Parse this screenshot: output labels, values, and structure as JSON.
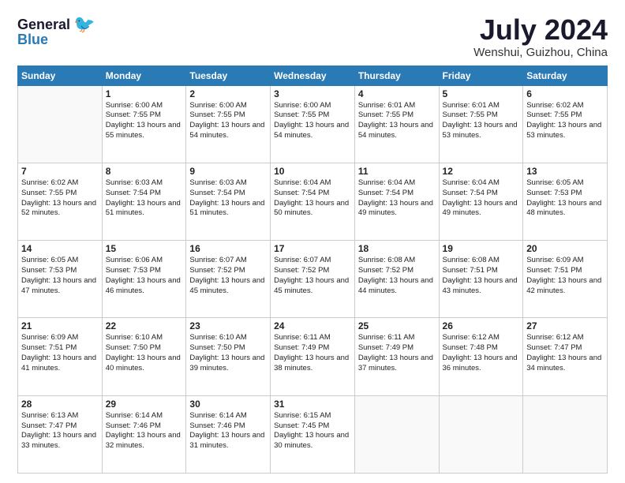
{
  "header": {
    "logo_general": "General",
    "logo_blue": "Blue",
    "month_title": "July 2024",
    "location": "Wenshui, Guizhou, China"
  },
  "weekdays": [
    "Sunday",
    "Monday",
    "Tuesday",
    "Wednesday",
    "Thursday",
    "Friday",
    "Saturday"
  ],
  "weeks": [
    [
      {
        "day": "",
        "sunrise": "",
        "sunset": "",
        "daylight": ""
      },
      {
        "day": "1",
        "sunrise": "Sunrise: 6:00 AM",
        "sunset": "Sunset: 7:55 PM",
        "daylight": "Daylight: 13 hours and 55 minutes."
      },
      {
        "day": "2",
        "sunrise": "Sunrise: 6:00 AM",
        "sunset": "Sunset: 7:55 PM",
        "daylight": "Daylight: 13 hours and 54 minutes."
      },
      {
        "day": "3",
        "sunrise": "Sunrise: 6:00 AM",
        "sunset": "Sunset: 7:55 PM",
        "daylight": "Daylight: 13 hours and 54 minutes."
      },
      {
        "day": "4",
        "sunrise": "Sunrise: 6:01 AM",
        "sunset": "Sunset: 7:55 PM",
        "daylight": "Daylight: 13 hours and 54 minutes."
      },
      {
        "day": "5",
        "sunrise": "Sunrise: 6:01 AM",
        "sunset": "Sunset: 7:55 PM",
        "daylight": "Daylight: 13 hours and 53 minutes."
      },
      {
        "day": "6",
        "sunrise": "Sunrise: 6:02 AM",
        "sunset": "Sunset: 7:55 PM",
        "daylight": "Daylight: 13 hours and 53 minutes."
      }
    ],
    [
      {
        "day": "7",
        "sunrise": "Sunrise: 6:02 AM",
        "sunset": "Sunset: 7:55 PM",
        "daylight": "Daylight: 13 hours and 52 minutes."
      },
      {
        "day": "8",
        "sunrise": "Sunrise: 6:03 AM",
        "sunset": "Sunset: 7:54 PM",
        "daylight": "Daylight: 13 hours and 51 minutes."
      },
      {
        "day": "9",
        "sunrise": "Sunrise: 6:03 AM",
        "sunset": "Sunset: 7:54 PM",
        "daylight": "Daylight: 13 hours and 51 minutes."
      },
      {
        "day": "10",
        "sunrise": "Sunrise: 6:04 AM",
        "sunset": "Sunset: 7:54 PM",
        "daylight": "Daylight: 13 hours and 50 minutes."
      },
      {
        "day": "11",
        "sunrise": "Sunrise: 6:04 AM",
        "sunset": "Sunset: 7:54 PM",
        "daylight": "Daylight: 13 hours and 49 minutes."
      },
      {
        "day": "12",
        "sunrise": "Sunrise: 6:04 AM",
        "sunset": "Sunset: 7:54 PM",
        "daylight": "Daylight: 13 hours and 49 minutes."
      },
      {
        "day": "13",
        "sunrise": "Sunrise: 6:05 AM",
        "sunset": "Sunset: 7:53 PM",
        "daylight": "Daylight: 13 hours and 48 minutes."
      }
    ],
    [
      {
        "day": "14",
        "sunrise": "Sunrise: 6:05 AM",
        "sunset": "Sunset: 7:53 PM",
        "daylight": "Daylight: 13 hours and 47 minutes."
      },
      {
        "day": "15",
        "sunrise": "Sunrise: 6:06 AM",
        "sunset": "Sunset: 7:53 PM",
        "daylight": "Daylight: 13 hours and 46 minutes."
      },
      {
        "day": "16",
        "sunrise": "Sunrise: 6:07 AM",
        "sunset": "Sunset: 7:52 PM",
        "daylight": "Daylight: 13 hours and 45 minutes."
      },
      {
        "day": "17",
        "sunrise": "Sunrise: 6:07 AM",
        "sunset": "Sunset: 7:52 PM",
        "daylight": "Daylight: 13 hours and 45 minutes."
      },
      {
        "day": "18",
        "sunrise": "Sunrise: 6:08 AM",
        "sunset": "Sunset: 7:52 PM",
        "daylight": "Daylight: 13 hours and 44 minutes."
      },
      {
        "day": "19",
        "sunrise": "Sunrise: 6:08 AM",
        "sunset": "Sunset: 7:51 PM",
        "daylight": "Daylight: 13 hours and 43 minutes."
      },
      {
        "day": "20",
        "sunrise": "Sunrise: 6:09 AM",
        "sunset": "Sunset: 7:51 PM",
        "daylight": "Daylight: 13 hours and 42 minutes."
      }
    ],
    [
      {
        "day": "21",
        "sunrise": "Sunrise: 6:09 AM",
        "sunset": "Sunset: 7:51 PM",
        "daylight": "Daylight: 13 hours and 41 minutes."
      },
      {
        "day": "22",
        "sunrise": "Sunrise: 6:10 AM",
        "sunset": "Sunset: 7:50 PM",
        "daylight": "Daylight: 13 hours and 40 minutes."
      },
      {
        "day": "23",
        "sunrise": "Sunrise: 6:10 AM",
        "sunset": "Sunset: 7:50 PM",
        "daylight": "Daylight: 13 hours and 39 minutes."
      },
      {
        "day": "24",
        "sunrise": "Sunrise: 6:11 AM",
        "sunset": "Sunset: 7:49 PM",
        "daylight": "Daylight: 13 hours and 38 minutes."
      },
      {
        "day": "25",
        "sunrise": "Sunrise: 6:11 AM",
        "sunset": "Sunset: 7:49 PM",
        "daylight": "Daylight: 13 hours and 37 minutes."
      },
      {
        "day": "26",
        "sunrise": "Sunrise: 6:12 AM",
        "sunset": "Sunset: 7:48 PM",
        "daylight": "Daylight: 13 hours and 36 minutes."
      },
      {
        "day": "27",
        "sunrise": "Sunrise: 6:12 AM",
        "sunset": "Sunset: 7:47 PM",
        "daylight": "Daylight: 13 hours and 34 minutes."
      }
    ],
    [
      {
        "day": "28",
        "sunrise": "Sunrise: 6:13 AM",
        "sunset": "Sunset: 7:47 PM",
        "daylight": "Daylight: 13 hours and 33 minutes."
      },
      {
        "day": "29",
        "sunrise": "Sunrise: 6:14 AM",
        "sunset": "Sunset: 7:46 PM",
        "daylight": "Daylight: 13 hours and 32 minutes."
      },
      {
        "day": "30",
        "sunrise": "Sunrise: 6:14 AM",
        "sunset": "Sunset: 7:46 PM",
        "daylight": "Daylight: 13 hours and 31 minutes."
      },
      {
        "day": "31",
        "sunrise": "Sunrise: 6:15 AM",
        "sunset": "Sunset: 7:45 PM",
        "daylight": "Daylight: 13 hours and 30 minutes."
      },
      {
        "day": "",
        "sunrise": "",
        "sunset": "",
        "daylight": ""
      },
      {
        "day": "",
        "sunrise": "",
        "sunset": "",
        "daylight": ""
      },
      {
        "day": "",
        "sunrise": "",
        "sunset": "",
        "daylight": ""
      }
    ]
  ]
}
